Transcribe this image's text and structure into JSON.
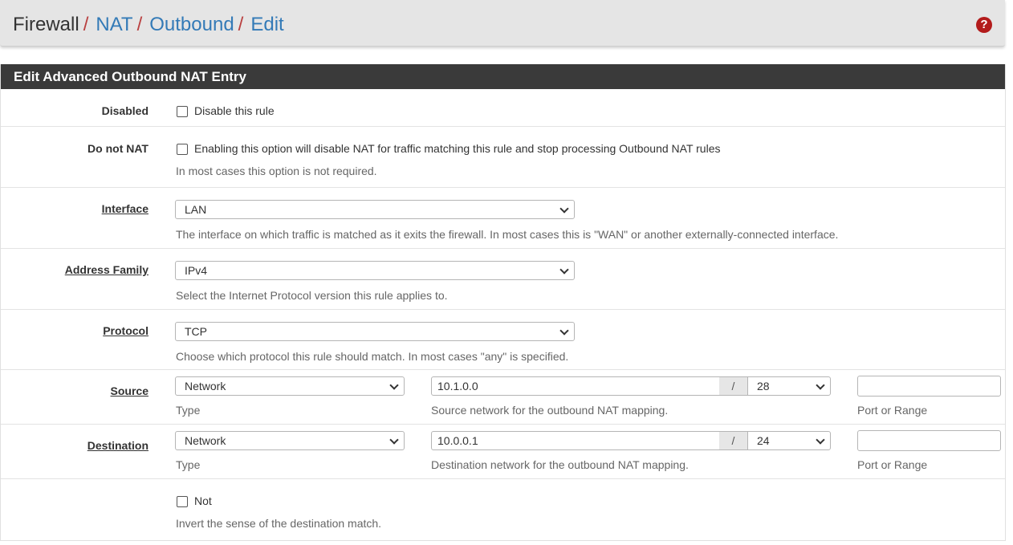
{
  "breadcrumb": {
    "root": "Firewall",
    "nat": "NAT",
    "outbound": "Outbound",
    "edit": "Edit",
    "separator": "/"
  },
  "help_icon": "question-circle-icon",
  "panel": {
    "title": "Edit Advanced Outbound NAT Entry"
  },
  "fields": {
    "disabled": {
      "label": "Disabled",
      "checkbox_label": "Disable this rule",
      "checked": false
    },
    "do_not_nat": {
      "label": "Do not NAT",
      "checkbox_label": "Enabling this option will disable NAT for traffic matching this rule and stop processing Outbound NAT rules",
      "help": "In most cases this option is not required.",
      "checked": false
    },
    "interface": {
      "label": "Interface",
      "value": "LAN",
      "help": "The interface on which traffic is matched as it exits the firewall. In most cases this is \"WAN\" or another externally-connected interface."
    },
    "address_family": {
      "label": "Address Family",
      "value": "IPv4",
      "help": "Select the Internet Protocol version this rule applies to."
    },
    "protocol": {
      "label": "Protocol",
      "value": "TCP",
      "help": "Choose which protocol this rule should match. In most cases \"any\" is specified."
    },
    "source": {
      "label": "Source",
      "type_value": "Network",
      "type_help": "Type",
      "address": "10.1.0.0",
      "mask_separator": "/",
      "mask": "28",
      "address_help": "Source network for the outbound NAT mapping.",
      "port": "",
      "port_help": "Port or Range"
    },
    "destination": {
      "label": "Destination",
      "type_value": "Network",
      "type_help": "Type",
      "address": "10.0.0.1",
      "mask_separator": "/",
      "mask": "24",
      "address_help": "Destination network for the outbound NAT mapping.",
      "port": "",
      "port_help": "Port or Range"
    },
    "not": {
      "checkbox_label": "Not",
      "help": "Invert the sense of the destination match.",
      "checked": false
    }
  },
  "colors": {
    "header_bg": "#e5e5e5",
    "panel_head_bg": "#3a3a3a",
    "link": "#337ab7",
    "separator": "#b94040",
    "help_icon": "#b31b1b"
  }
}
